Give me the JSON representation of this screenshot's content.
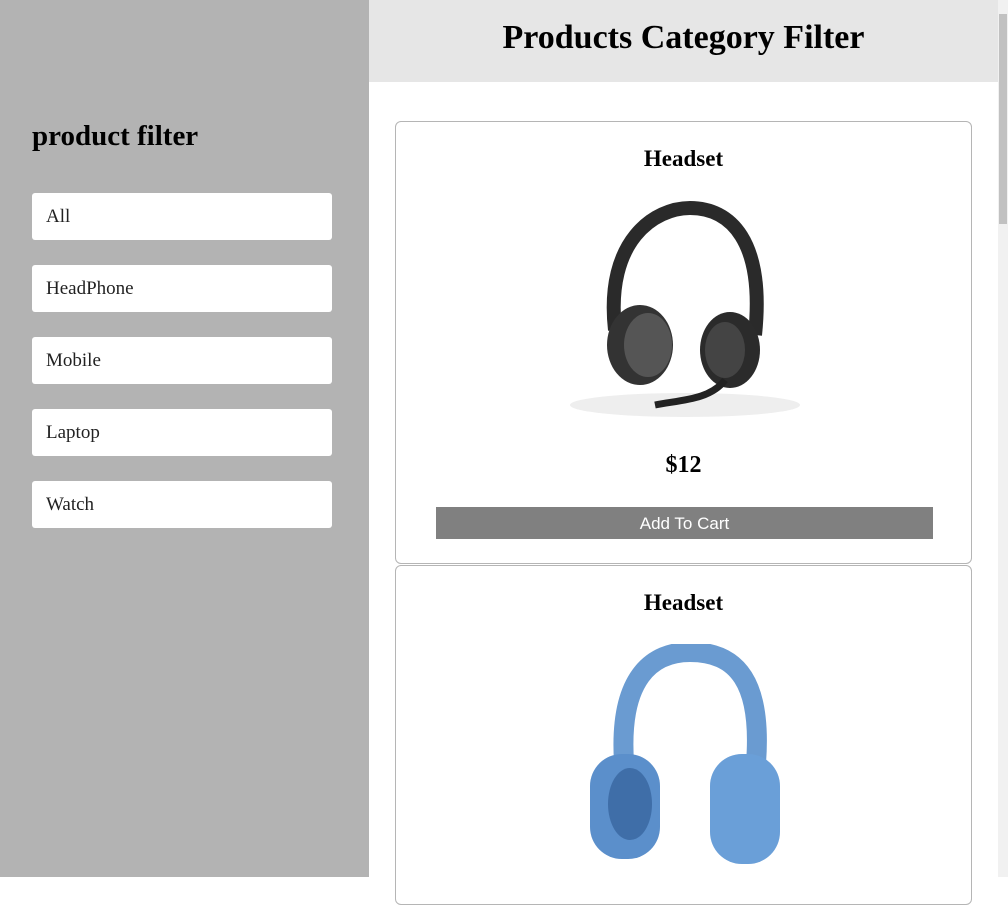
{
  "sidebar": {
    "title": "product filter",
    "filters": [
      "All",
      "HeadPhone",
      "Mobile",
      "Laptop",
      "Watch"
    ]
  },
  "header": {
    "title": "Products Category Filter"
  },
  "products": [
    {
      "name": "Headset",
      "price": "$12",
      "button": "Add To Cart",
      "image": "black-headset-with-mic"
    },
    {
      "name": "Headset",
      "image": "blue-over-ear-headphones"
    }
  ]
}
